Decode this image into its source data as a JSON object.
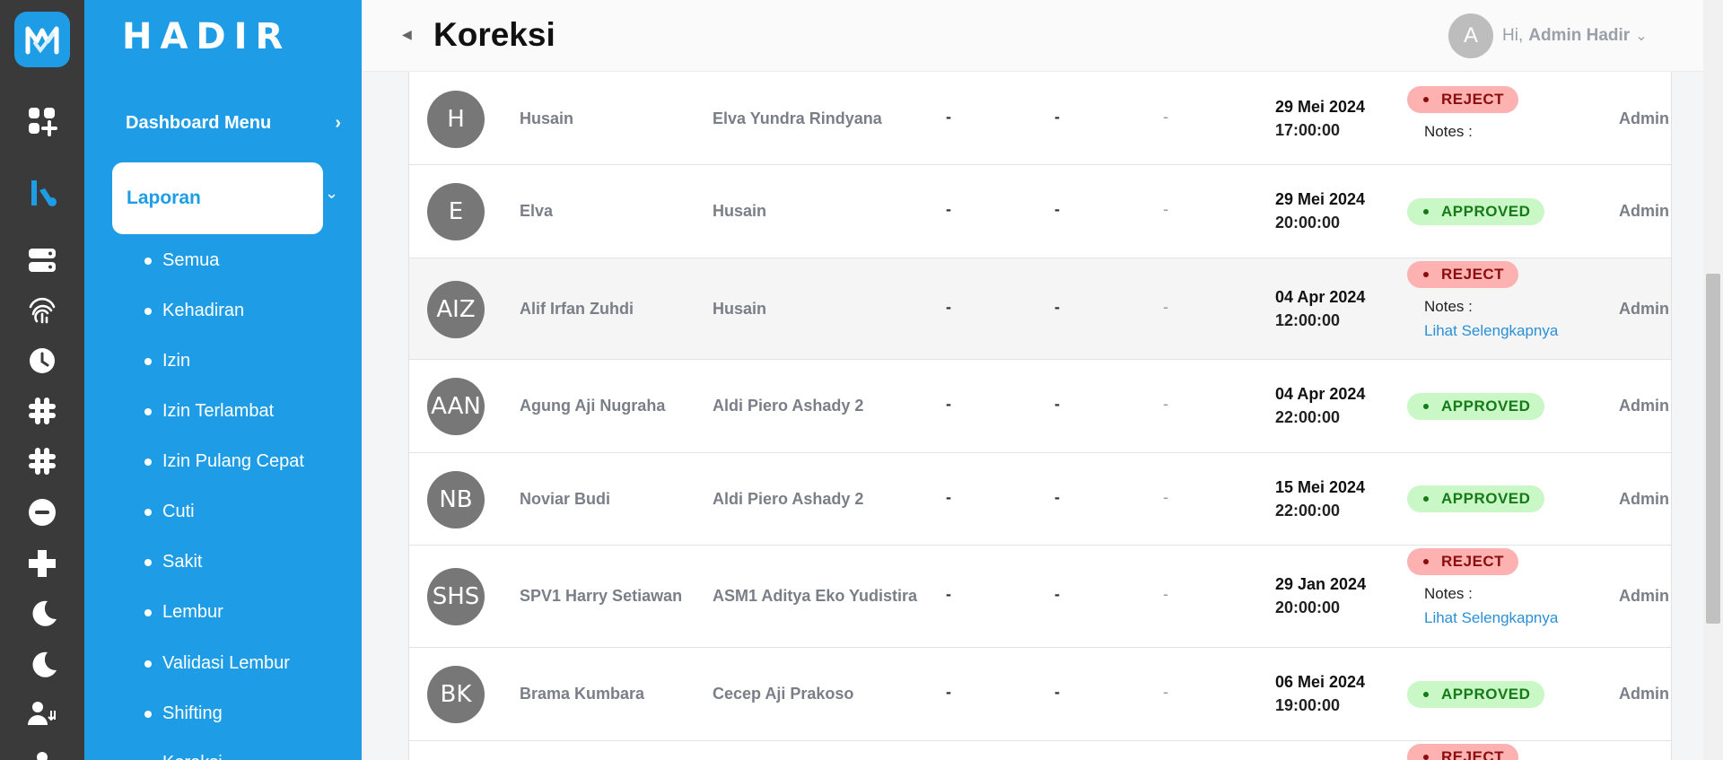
{
  "app": {
    "brand": "HADIR"
  },
  "rail": {
    "icons": [
      "apps-add-icon",
      "logo-b-icon",
      "server-icon",
      "fingerprint-icon",
      "clock-icon",
      "grid-hash-icon",
      "grid-hash-icon",
      "minus-circle-icon",
      "plus-icon",
      "moon-icon",
      "moon-icon",
      "user-switch-icon",
      "user-icon"
    ]
  },
  "nav": {
    "dashboard_label": "Dashboard Menu",
    "active_label": "Laporan",
    "sub_items": [
      "Semua",
      "Kehadiran",
      "Izin",
      "Izin Terlambat",
      "Izin Pulang Cepat",
      "Cuti",
      "Sakit",
      "Lembur",
      "Validasi Lembur",
      "Shifting",
      "Koreksi"
    ]
  },
  "header": {
    "title": "Koreksi",
    "avatar_initial": "A",
    "greeting": "Hi,",
    "user_name": "Admin Hadir"
  },
  "rows": [
    {
      "initials": "H",
      "name": "Husain",
      "approver": "Elva Yundra Rindyana",
      "c1": "-",
      "c2": "-",
      "c3": "-",
      "date": "29 Mei 2024",
      "time": "17:00:00",
      "status": "REJECT",
      "notes_label": "Notes :",
      "more": "",
      "by": "Admin"
    },
    {
      "initials": "E",
      "name": "Elva",
      "approver": "Husain",
      "c1": "-",
      "c2": "-",
      "c3": "-",
      "date": "29 Mei 2024",
      "time": "20:00:00",
      "status": "APPROVED",
      "notes_label": "",
      "more": "",
      "by": "Admin"
    },
    {
      "initials": "AIZ",
      "name": "Alif Irfan Zuhdi",
      "approver": "Husain",
      "c1": "-",
      "c2": "-",
      "c3": "-",
      "date": "04 Apr 2024",
      "time": "12:00:00",
      "status": "REJECT",
      "notes_label": "Notes :",
      "more": "Lihat Selengkapnya",
      "by": "Admin"
    },
    {
      "initials": "AAN",
      "name": "Agung Aji Nugraha",
      "approver": "Aldi Piero Ashady 2",
      "c1": "-",
      "c2": "-",
      "c3": "-",
      "date": "04 Apr 2024",
      "time": "22:00:00",
      "status": "APPROVED",
      "notes_label": "",
      "more": "",
      "by": "Admin"
    },
    {
      "initials": "NB",
      "name": "Noviar Budi",
      "approver": "Aldi Piero Ashady 2",
      "c1": "-",
      "c2": "-",
      "c3": "-",
      "date": "15 Mei 2024",
      "time": "22:00:00",
      "status": "APPROVED",
      "notes_label": "",
      "more": "",
      "by": "Admin"
    },
    {
      "initials": "SHS",
      "name": "SPV1 Harry Setiawan",
      "approver": "ASM1 Aditya Eko Yudistira",
      "c1": "-",
      "c2": "-",
      "c3": "-",
      "date": "29 Jan 2024",
      "time": "20:00:00",
      "status": "REJECT",
      "notes_label": "Notes :",
      "more": "Lihat Selengkapnya",
      "by": "Admin"
    },
    {
      "initials": "BK",
      "name": "Brama Kumbara",
      "approver": "Cecep Aji Prakoso",
      "c1": "-",
      "c2": "-",
      "c3": "-",
      "date": "06 Mei 2024",
      "time": "19:00:00",
      "status": "APPROVED",
      "notes_label": "",
      "more": "",
      "by": "Admin"
    },
    {
      "initials": "",
      "name": "",
      "approver": "",
      "c1": "",
      "c2": "",
      "c3": "",
      "date": "",
      "time": "",
      "status": "REJECT",
      "notes_label": "",
      "more": "",
      "by": ""
    }
  ]
}
